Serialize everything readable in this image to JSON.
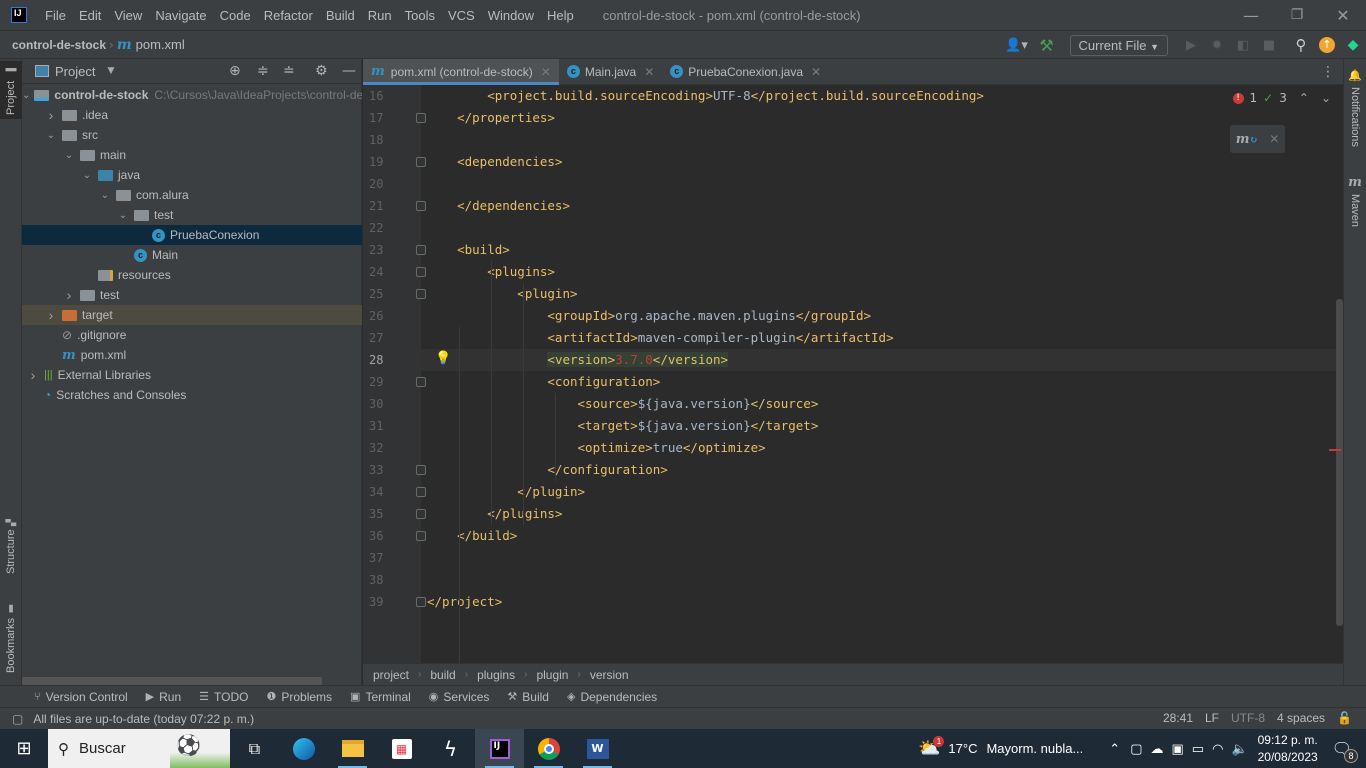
{
  "titlebar": {
    "menu": [
      "File",
      "Edit",
      "View",
      "Navigate",
      "Code",
      "Refactor",
      "Build",
      "Run",
      "Tools",
      "VCS",
      "Window",
      "Help"
    ],
    "title": "control-de-stock - pom.xml (control-de-stock)",
    "controls": {
      "minimize": "—",
      "restore": "❐",
      "close": "✕"
    }
  },
  "navbar": {
    "project": "control-de-stock",
    "file": "pom.xml",
    "run_config": "Current File"
  },
  "left_stripe": {
    "project": "Project",
    "structure": "Structure",
    "bookmarks": "Bookmarks"
  },
  "project_panel": {
    "title": "Project",
    "tree": [
      {
        "label": "control-de-stock",
        "path": "C:\\Cursos\\Java\\IdeaProjects\\control-de-stock",
        "depth": 0,
        "arrow": "down",
        "icon": "module-folder"
      },
      {
        "label": ".idea",
        "depth": 1,
        "arrow": "right",
        "icon": "folder"
      },
      {
        "label": "src",
        "depth": 1,
        "arrow": "down",
        "icon": "folder"
      },
      {
        "label": "main",
        "depth": 2,
        "arrow": "down",
        "icon": "folder"
      },
      {
        "label": "java",
        "depth": 3,
        "arrow": "down",
        "icon": "source-folder"
      },
      {
        "label": "com.alura",
        "depth": 4,
        "arrow": "down",
        "icon": "package"
      },
      {
        "label": "test",
        "depth": 5,
        "arrow": "down",
        "icon": "package"
      },
      {
        "label": "PruebaConexion",
        "depth": 6,
        "icon": "class",
        "selected": true
      },
      {
        "label": "Main",
        "depth": 5,
        "icon": "main-class"
      },
      {
        "label": "resources",
        "depth": 3,
        "icon": "resources-folder"
      },
      {
        "label": "test",
        "depth": 2,
        "arrow": "right",
        "icon": "folder"
      },
      {
        "label": "target",
        "depth": 1,
        "arrow": "right",
        "icon": "excluded-folder",
        "excluded": true
      },
      {
        "label": ".gitignore",
        "depth": 1,
        "icon": "ignore-file"
      },
      {
        "label": "pom.xml",
        "depth": 1,
        "icon": "maven-file"
      },
      {
        "label": "External Libraries",
        "depth": 0,
        "arrow": "right",
        "icon": "libraries"
      },
      {
        "label": "Scratches and Consoles",
        "depth": 0,
        "icon": "scratches"
      }
    ]
  },
  "tabs": [
    {
      "label": "pom.xml (control-de-stock)",
      "icon": "maven",
      "active": true
    },
    {
      "label": "Main.java",
      "icon": "main-class"
    },
    {
      "label": "PruebaConexion.java",
      "icon": "class"
    }
  ],
  "editor": {
    "current_line": 28,
    "inspections": {
      "errors": "1",
      "weak_warnings": "3"
    },
    "lines": [
      {
        "n": 16,
        "parts": [
          [
            "tag",
            "        <project.build.sourceEncoding>"
          ],
          [
            "txt",
            "UTF-8"
          ],
          [
            "tag",
            "</project.build.sourceEncoding>"
          ]
        ]
      },
      {
        "n": 17,
        "parts": [
          [
            "tag",
            "    </properties>"
          ]
        ]
      },
      {
        "n": 18,
        "parts": []
      },
      {
        "n": 19,
        "parts": [
          [
            "tag",
            "    <dependencies>"
          ]
        ]
      },
      {
        "n": 20,
        "parts": []
      },
      {
        "n": 21,
        "parts": [
          [
            "tag",
            "    </dependencies>"
          ]
        ]
      },
      {
        "n": 22,
        "parts": []
      },
      {
        "n": 23,
        "parts": [
          [
            "tag",
            "    <build>"
          ]
        ]
      },
      {
        "n": 24,
        "parts": [
          [
            "tag",
            "        <plugins>"
          ]
        ]
      },
      {
        "n": 25,
        "parts": [
          [
            "tag",
            "            <plugin>"
          ]
        ]
      },
      {
        "n": 26,
        "parts": [
          [
            "tag",
            "                <groupId>"
          ],
          [
            "txt",
            "org.apache.maven.plugins"
          ],
          [
            "tag",
            "</groupId>"
          ]
        ]
      },
      {
        "n": 27,
        "parts": [
          [
            "tag",
            "                <artifactId>"
          ],
          [
            "txt",
            "maven-compiler-plugin"
          ],
          [
            "tag",
            "</artifactId>"
          ]
        ]
      },
      {
        "n": 28,
        "parts": [
          [
            "tag",
            "                "
          ],
          [
            "taghl",
            "<version>"
          ],
          [
            "err",
            "3.7.0"
          ],
          [
            "taghl",
            "</version>"
          ]
        ]
      },
      {
        "n": 29,
        "parts": [
          [
            "tag",
            "                <configuration>"
          ]
        ]
      },
      {
        "n": 30,
        "parts": [
          [
            "tag",
            "                    <source>"
          ],
          [
            "txt",
            "${java.version}"
          ],
          [
            "tag",
            "</source>"
          ]
        ]
      },
      {
        "n": 31,
        "parts": [
          [
            "tag",
            "                    <target>"
          ],
          [
            "txt",
            "${java.version}"
          ],
          [
            "tag",
            "</target>"
          ]
        ]
      },
      {
        "n": 32,
        "parts": [
          [
            "tag",
            "                    <optimize>"
          ],
          [
            "txt",
            "true"
          ],
          [
            "tag",
            "</optimize>"
          ]
        ]
      },
      {
        "n": 33,
        "parts": [
          [
            "tag",
            "                </configuration>"
          ]
        ]
      },
      {
        "n": 34,
        "parts": [
          [
            "tag",
            "            </plugin>"
          ]
        ]
      },
      {
        "n": 35,
        "parts": [
          [
            "tag",
            "        </plugins>"
          ]
        ]
      },
      {
        "n": 36,
        "parts": [
          [
            "tag",
            "    </build>"
          ]
        ]
      },
      {
        "n": 37,
        "parts": []
      },
      {
        "n": 38,
        "parts": []
      },
      {
        "n": 39,
        "parts": [
          [
            "tag",
            "</project>"
          ]
        ]
      }
    ]
  },
  "breadcrumbs": [
    "project",
    "build",
    "plugins",
    "plugin",
    "version"
  ],
  "right_stripe": {
    "notifications": "Notifications",
    "maven": "Maven"
  },
  "tool_windows": [
    {
      "label": "Version Control",
      "icon": "vcs-icon"
    },
    {
      "label": "Run",
      "icon": "run-icon"
    },
    {
      "label": "TODO",
      "icon": "todo-icon"
    },
    {
      "label": "Problems",
      "icon": "problems-icon"
    },
    {
      "label": "Terminal",
      "icon": "terminal-icon"
    },
    {
      "label": "Services",
      "icon": "services-icon"
    },
    {
      "label": "Build",
      "icon": "build-icon"
    },
    {
      "label": "Dependencies",
      "icon": "dependencies-icon"
    }
  ],
  "statusbar": {
    "message": "All files are up-to-date (today 07:22 p. m.)",
    "position": "28:41",
    "line_sep": "LF",
    "encoding": "UTF-8",
    "indent": "4 spaces"
  },
  "taskbar": {
    "search_placeholder": "Buscar",
    "weather_temp": "17°C",
    "weather_desc": "Mayorm. nubla...",
    "weather_badge": "1",
    "time": "09:12 p. m.",
    "date": "20/08/2023",
    "notif_count": "8"
  },
  "colors": {
    "accent": "#4a88c7",
    "tag": "#e8bf6a",
    "text": "#a9b7c6",
    "error": "#bc3f3c",
    "selection": "#0d293e"
  }
}
